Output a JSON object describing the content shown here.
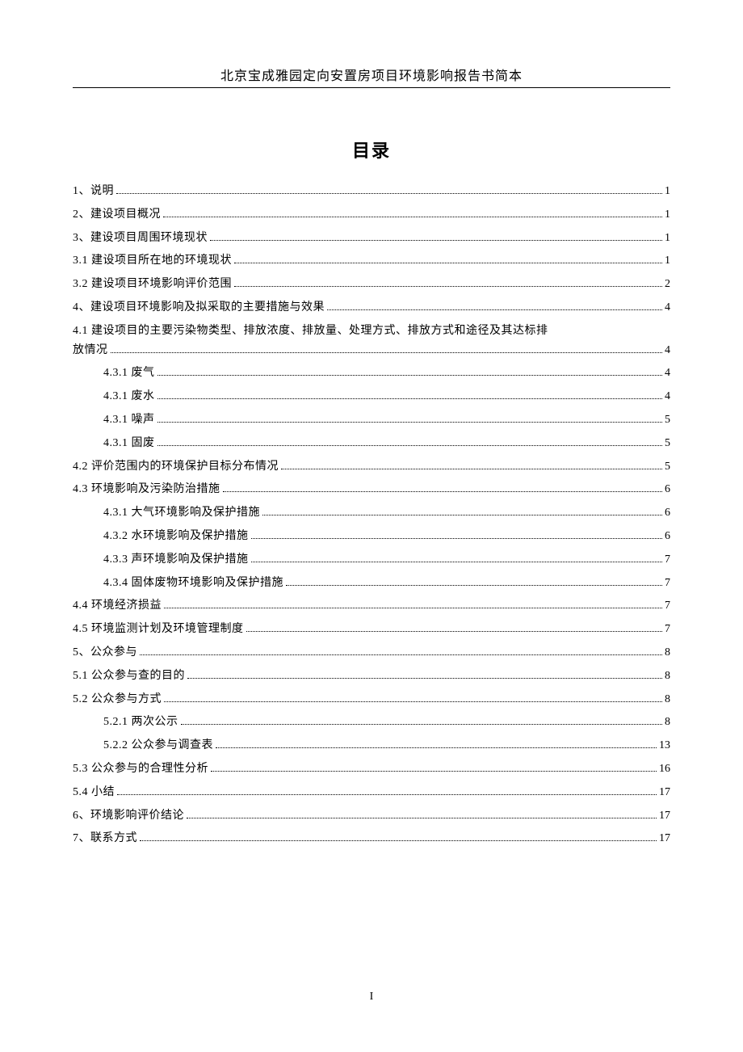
{
  "header": {
    "title": "北京宝成雅园定向安置房项目环境影响报告书简本"
  },
  "toc": {
    "title": "目录",
    "items": [
      {
        "label": "1、说明",
        "page": "1",
        "indent": 0
      },
      {
        "label": "2、建设项目概况",
        "page": "1",
        "indent": 0
      },
      {
        "label": "3、建设项目周围环境现状",
        "page": "1",
        "indent": 0
      },
      {
        "label": "3.1 建设项目所在地的环境现状",
        "page": "1",
        "indent": 0
      },
      {
        "label": "3.2 建设项目环境影响评价范围",
        "page": "2",
        "indent": 0
      },
      {
        "label": "4、建设项目环境影响及拟采取的主要措施与效果",
        "page": "4",
        "indent": 0
      },
      {
        "label": "4.1 建设项目的主要污染物类型、排放浓度、排放量、处理方式、排放方式和途径及其达标排",
        "label2": "放情况",
        "page": "4",
        "indent": 0,
        "wrap": true
      },
      {
        "label": "4.3.1 废气",
        "page": "4",
        "indent": 1
      },
      {
        "label": "4.3.1 废水",
        "page": "4",
        "indent": 1
      },
      {
        "label": "4.3.1 噪声",
        "page": "5",
        "indent": 1
      },
      {
        "label": "4.3.1 固废",
        "page": "5",
        "indent": 1
      },
      {
        "label": "4.2 评价范围内的环境保护目标分布情况",
        "page": "5",
        "indent": 0
      },
      {
        "label": "4.3 环境影响及污染防治措施",
        "page": "6",
        "indent": 0
      },
      {
        "label": "4.3.1 大气环境影响及保护措施",
        "page": "6",
        "indent": 1
      },
      {
        "label": "4.3.2 水环境影响及保护措施",
        "page": "6",
        "indent": 1
      },
      {
        "label": "4.3.3 声环境影响及保护措施",
        "page": "7",
        "indent": 1
      },
      {
        "label": "4.3.4 固体废物环境影响及保护措施",
        "page": "7",
        "indent": 1
      },
      {
        "label": "4.4 环境经济损益",
        "page": "7",
        "indent": 0
      },
      {
        "label": "4.5 环境监测计划及环境管理制度",
        "page": "7",
        "indent": 0
      },
      {
        "label": "5、公众参与",
        "page": "8",
        "indent": 0
      },
      {
        "label": "5.1 公众参与查的目的",
        "page": "8",
        "indent": 0
      },
      {
        "label": "5.2 公众参与方式",
        "page": "8",
        "indent": 0
      },
      {
        "label": "5.2.1 两次公示",
        "page": "8",
        "indent": 1
      },
      {
        "label": "5.2.2 公众参与调查表",
        "page": "13",
        "indent": 1
      },
      {
        "label": "5.3 公众参与的合理性分析",
        "page": "16",
        "indent": 0
      },
      {
        "label": "5.4 小结",
        "page": "17",
        "indent": 0
      },
      {
        "label": "6、环境影响评价结论",
        "page": "17",
        "indent": 0
      },
      {
        "label": "7、联系方式",
        "page": "17",
        "indent": 0
      }
    ]
  },
  "footer": {
    "page_number": "I"
  }
}
